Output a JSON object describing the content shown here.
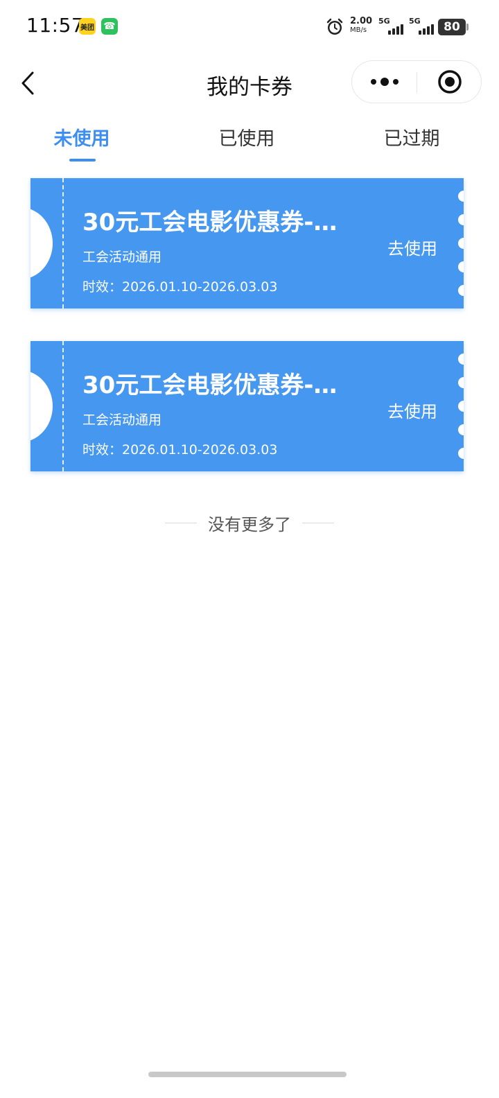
{
  "status_bar": {
    "time": "11:57",
    "app_badges": [
      {
        "name": "meituan-icon",
        "text": "美团"
      },
      {
        "name": "call-app-icon",
        "text": "☎"
      }
    ],
    "net_speed_value": "2.00",
    "net_speed_unit": "MB/s",
    "signal_1_gen": "5G",
    "signal_2_gen": "5G",
    "battery_level": "80"
  },
  "nav": {
    "title": "我的卡券",
    "back_icon": "chevron-left-icon",
    "more_icon": "more-dots-icon",
    "close_icon": "target-circle-icon"
  },
  "tabs": {
    "active_color": "#3d8ef0",
    "items": [
      {
        "label": "未使用",
        "active": true
      },
      {
        "label": "已使用",
        "active": false
      },
      {
        "label": "已过期",
        "active": false
      }
    ]
  },
  "coupons": [
    {
      "title": "30元工会电影优惠券-…",
      "scope": "工会活动通用",
      "validity": "时效：2026.01.10-2026.03.03",
      "action": "去使用"
    },
    {
      "title": "30元工会电影优惠券-…",
      "scope": "工会活动通用",
      "validity": "时效：2026.01.10-2026.03.03",
      "action": "去使用"
    }
  ],
  "coupon_color": "#4697f0",
  "end_of_list": "没有更多了"
}
